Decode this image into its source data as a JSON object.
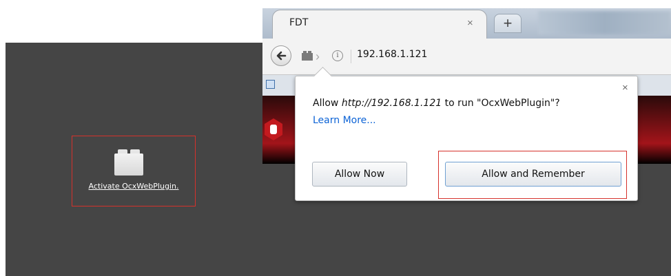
{
  "plugin_panel": {
    "activate_link": "Activate OcxWebPlugin."
  },
  "browser": {
    "tab_title": "FDT",
    "tab_close": "×",
    "new_tab": "+",
    "info_glyph": "i",
    "url": "192.168.1.121"
  },
  "popup": {
    "close": "×",
    "message_prefix": "Allow ",
    "message_origin": "http://192.168.1.121",
    "message_suffix": " to run \"OcxWebPlugin\"?",
    "learn_more": "Learn More...",
    "allow_now": "Allow Now",
    "allow_remember": "Allow and Remember"
  },
  "colors": {
    "panel_bg": "#454545",
    "highlight": "#d6312b",
    "link_blue": "#0c63d6"
  },
  "icons": [
    "plugin-brick-icon",
    "back-arrow-icon",
    "plugin-indicator-icon",
    "info-icon",
    "close-icon",
    "new-tab-icon",
    "bookmark-icon",
    "site-logo-icon"
  ]
}
